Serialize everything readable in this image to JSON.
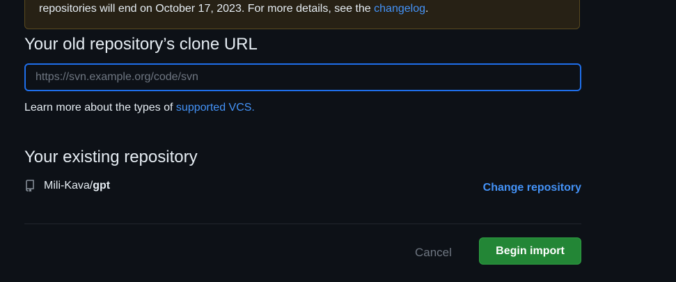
{
  "notice": {
    "text": "repositories will end on October 17, 2023. For more details, see the ",
    "link": "changelog",
    "suffix": "."
  },
  "clone_url": {
    "title": "Your old repository’s clone URL",
    "placeholder": "https://svn.example.org/code/svn",
    "value": "",
    "help_text": "Learn more about the types of ",
    "help_link": "supported VCS."
  },
  "existing_repo": {
    "title": "Your existing repository",
    "owner": "Mili-Kava/",
    "name": "gpt",
    "change_label": "Change repository"
  },
  "actions": {
    "cancel_label": "Cancel",
    "begin_label": "Begin import"
  },
  "colors": {
    "background": "#0d1117",
    "link": "#4493f8",
    "primary_button": "#238636",
    "input_focus_border": "#1f6feb"
  }
}
